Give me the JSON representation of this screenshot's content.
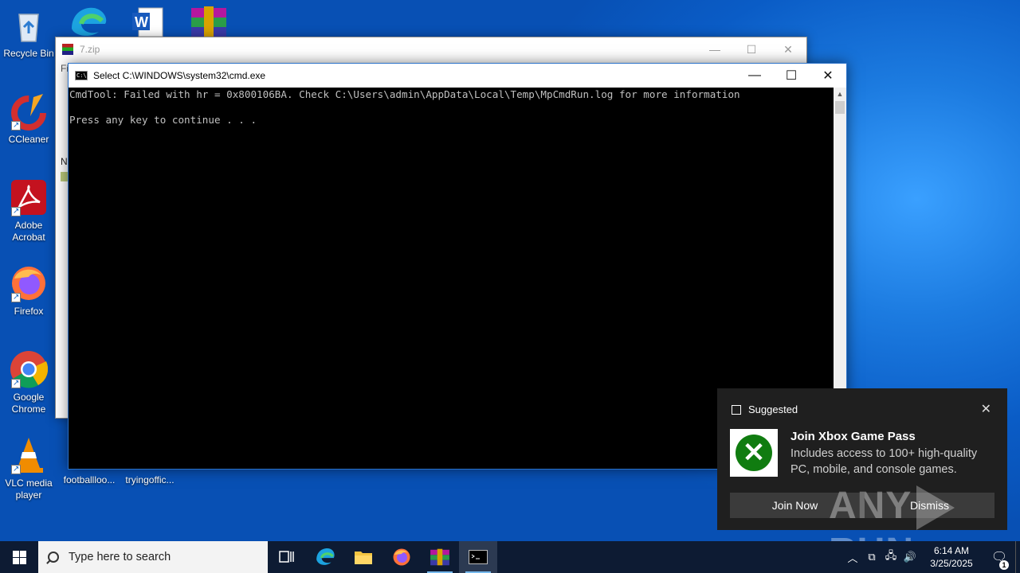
{
  "desktop": {
    "icons": [
      {
        "label": "Recycle Bin"
      },
      {
        "label": "CCleaner"
      },
      {
        "label": "Adobe Acrobat"
      },
      {
        "label": "Firefox"
      },
      {
        "label": "Google Chrome"
      },
      {
        "label": "VLC media player"
      },
      {
        "label": "footballloo..."
      },
      {
        "label": "tryingoffic..."
      }
    ]
  },
  "bg_window": {
    "title": "7.zip",
    "menu_fragment": "Fi",
    "list_fragment": "N"
  },
  "cmd_window": {
    "title": "Select C:\\WINDOWS\\system32\\cmd.exe",
    "lines": [
      "CmdTool: Failed with hr = 0x800106BA. Check C:\\Users\\admin\\AppData\\Local\\Temp\\MpCmdRun.log for more information",
      "",
      "Press any key to continue . . ."
    ]
  },
  "toast": {
    "header": "Suggested",
    "title": "Join Xbox Game Pass",
    "body": "Includes access to 100+ high-quality PC, mobile, and console games.",
    "primary_button": "Join Now",
    "secondary_button": "Dismiss"
  },
  "watermark": {
    "left": "ANY",
    "right": "RUN"
  },
  "taskbar": {
    "search_placeholder": "Type here to search",
    "time": "6:14 AM",
    "date": "3/25/2025",
    "notification_count": "1"
  }
}
